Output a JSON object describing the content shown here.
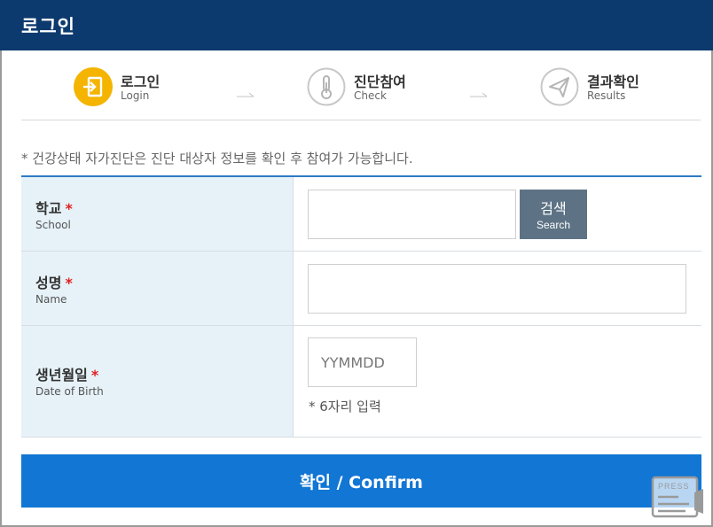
{
  "header": {
    "title": "로그인"
  },
  "steps": [
    {
      "ko": "로그인",
      "en": "Login",
      "icon": "login-icon",
      "active": true
    },
    {
      "ko": "진단참여",
      "en": "Check",
      "icon": "thermometer-icon",
      "active": false
    },
    {
      "ko": "결과확인",
      "en": "Results",
      "icon": "send-icon",
      "active": false
    }
  ],
  "notice": "* 건강상태 자가진단은 진단 대상자 정보를 확인 후 참여가 가능합니다.",
  "form": {
    "school": {
      "label_ko": "학교",
      "label_en": "School",
      "required_mark": "*",
      "value": "",
      "placeholder": ""
    },
    "search": {
      "label_ko": "검색",
      "label_en": "Search"
    },
    "name": {
      "label_ko": "성명",
      "label_en": "Name",
      "required_mark": "*",
      "value": "",
      "placeholder": ""
    },
    "birth": {
      "label_ko": "생년월일",
      "label_en": "Date of Birth",
      "required_mark": "*",
      "value": "",
      "placeholder": "YYMMDD",
      "hint": "* 6자리 입력"
    }
  },
  "confirm_label": "확인 / Confirm",
  "watermark": "PRESS",
  "colors": {
    "header": "#0d3a6e",
    "active_step": "#f4b400",
    "primary": "#1176d4",
    "search_button": "#5d7385",
    "label_bg": "#e6f2f8",
    "required": "#e02020"
  }
}
